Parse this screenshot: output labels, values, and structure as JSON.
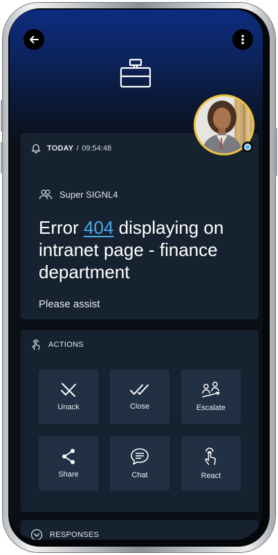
{
  "icons": {
    "back": "arrow-left-icon",
    "more": "more-vertical-icon",
    "header": "toolbox-icon",
    "bell": "bell-icon",
    "team": "team-icon",
    "actions": "touch-icon",
    "responses": "chevron-down-circle-icon"
  },
  "colors": {
    "accent": "#4aa9ea",
    "avatar_ring": "#f0c23a",
    "card": "#172230",
    "tile": "#223043"
  },
  "alert": {
    "date_label": "TODAY",
    "date_separator": "/",
    "time": "09:54:48",
    "team": "Super SIGNL4",
    "title_prefix": "Error",
    "title_link": "404",
    "title_suffix": "displaying on intranet page - finance department",
    "message": "Please assist"
  },
  "actions": {
    "heading": "ACTIONS",
    "items": [
      {
        "label": "Unack",
        "icon": "unacknowledge-icon"
      },
      {
        "label": "Close",
        "icon": "double-check-icon"
      },
      {
        "label": "Escalate",
        "icon": "escalate-icon"
      },
      {
        "label": "Share",
        "icon": "share-icon"
      },
      {
        "label": "Chat",
        "icon": "chat-icon"
      },
      {
        "label": "React",
        "icon": "react-hand-icon"
      }
    ]
  },
  "responses": {
    "heading": "RESPONSES"
  }
}
